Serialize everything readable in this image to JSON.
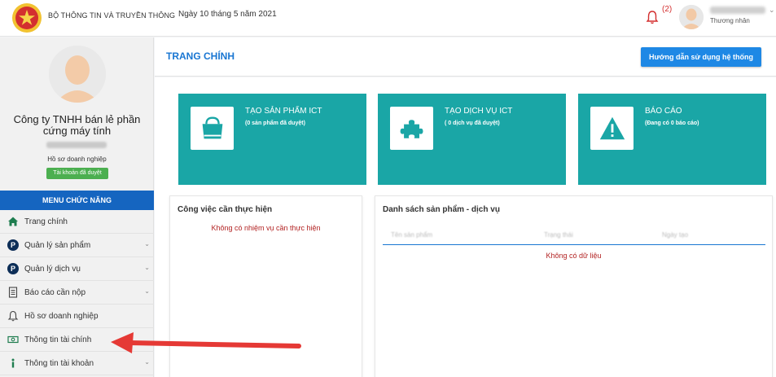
{
  "header": {
    "org_name": "BỘ THÔNG TIN VÀ TRUYỀN THÔNG",
    "date": "Ngày 10 tháng 5 năm 2021",
    "notification_count": "(2)",
    "user_role": "Thương nhân",
    "icons": [
      "emblem-icon",
      "bell-icon",
      "avatar",
      "chevron-down-icon"
    ]
  },
  "sidebar": {
    "company_name": "Công ty TNHH bán lẻ phần cứng máy tính",
    "profile_label": "Hồ sơ doanh nghiệp",
    "status_badge": "Tài khoản đã duyệt",
    "menu_title": "MENU CHỨC NĂNG",
    "items": [
      {
        "label": "Trang chính",
        "icon": "home-icon",
        "has_chevron": false
      },
      {
        "label": "Quản lý sản phẩm",
        "icon": "p-circle-icon",
        "has_chevron": true
      },
      {
        "label": "Quản lý dịch vụ",
        "icon": "p-circle-icon",
        "has_chevron": true
      },
      {
        "label": "Báo cáo cần nộp",
        "icon": "document-icon",
        "has_chevron": true
      },
      {
        "label": "Hồ sơ doanh nghiệp",
        "icon": "bell-icon",
        "has_chevron": false
      },
      {
        "label": "Thông tin tài chính",
        "icon": "money-icon",
        "has_chevron": false
      },
      {
        "label": "Thông tin tài khoản",
        "icon": "info-icon",
        "has_chevron": true
      }
    ]
  },
  "main": {
    "page_title": "TRANG CHÍNH",
    "guide_button": "Hướng dẫn sử dụng hệ thống",
    "tiles": [
      {
        "title": "TẠO SẢN PHẨM ICT",
        "subtitle": "(0 sản phẩm đã duyệt)",
        "icon": "shopping-bag-icon"
      },
      {
        "title": "TẠO DỊCH VỤ ICT",
        "subtitle": "( 0 dịch vụ đã duyệt)",
        "icon": "puzzle-icon"
      },
      {
        "title": "BÁO CÁO",
        "subtitle": "(Đang có 0 báo cáo)",
        "icon": "warning-icon"
      }
    ],
    "tasks_panel": {
      "title": "Công việc cần thực hiện",
      "empty": "Không có nhiệm vụ cần thực hiện"
    },
    "products_panel": {
      "title": "Danh sách sản phẩm - dịch vụ",
      "columns": [
        "Tên sản phẩm",
        "Trạng thái",
        "Ngày tạo"
      ],
      "empty": "Không có dữ liệu"
    }
  },
  "colors": {
    "tile": "#1aa6a6",
    "menu_header": "#1565c0",
    "badge": "#4caf50",
    "arrow": "#e53935",
    "empty_text": "#b22222"
  }
}
